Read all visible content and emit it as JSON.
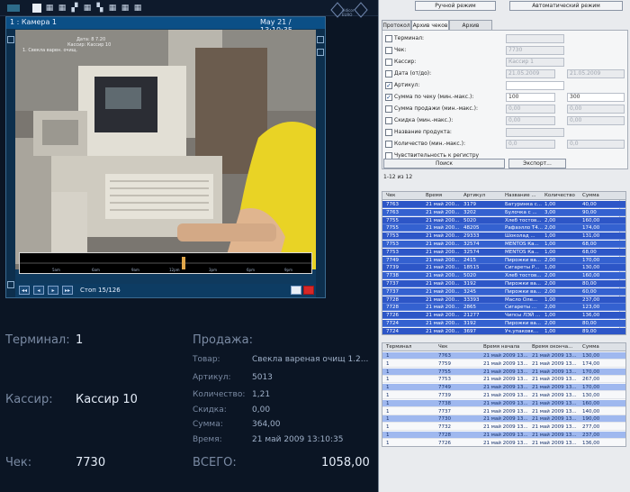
{
  "brand": {
    "line1": "vidicor",
    "line2": "EURO"
  },
  "camera": {
    "title": "1 : Камера 1",
    "datetime": "May 21 / 13:10:35",
    "side_tab": "1 : Камера 1",
    "overlay": [
      "Дата: 8 7.20",
      "Кассир: Кассир 10",
      "1. Свекла варен. очищ."
    ],
    "timeline_ticks": [
      "5am",
      "6am",
      "9am",
      "12pm",
      "3pm",
      "6pm",
      "9pm"
    ],
    "frame_counter": "Стоп  15/126"
  },
  "left_info": {
    "terminal_label": "Терминал:",
    "terminal_value": "1",
    "cashier_label": "Кассир:",
    "cashier_value": "Кассир 10",
    "check_label": "Чек:",
    "check_value": "7730",
    "sale_label": "Продажа:",
    "product_label": "Товар:",
    "product_value": "Свекла вареная очищ 1.2...",
    "article_label": "Артикул:",
    "article_value": "5013",
    "qty_label": "Количество:",
    "qty_value": "1,21",
    "discount_label": "Скидка:",
    "discount_value": "0,00",
    "sum_label": "Сумма:",
    "sum_value": "364,00",
    "time_label": "Время:",
    "time_value": "21 май 2009 13:10:35",
    "total_label": "ВСЕГО:",
    "total_value": "1058,00"
  },
  "right": {
    "manual_mode": "Ручной режим",
    "auto_mode": "Автоматический режим",
    "tabs": [
      "Протокол",
      "Архив чеков",
      "Архив событий"
    ],
    "filters": [
      {
        "label": "Терминал:",
        "checked": false,
        "v1": "",
        "v2": ""
      },
      {
        "label": "Чек:",
        "checked": false,
        "v1": "7730",
        "v2": ""
      },
      {
        "label": "Кассир:",
        "checked": false,
        "v1": "Кассир 1",
        "v2": ""
      },
      {
        "label": "Дата (от/до):",
        "checked": false,
        "v1": "21.05.2009",
        "v2": "21.05.2009"
      },
      {
        "label": "Артикул:",
        "checked": true,
        "v1": "",
        "v2": ""
      },
      {
        "label": "Сумма по чеку (мин.-макс.):",
        "checked": true,
        "v1": "100",
        "v2": "300"
      },
      {
        "label": "Сумма продажи (мин.-макс.):",
        "checked": false,
        "v1": "0,00",
        "v2": "0,00"
      },
      {
        "label": "Скидка (мин.-макс.):",
        "checked": false,
        "v1": "0,00",
        "v2": "0,00"
      },
      {
        "label": "Название продукта:",
        "checked": false,
        "v1": "",
        "v2": ""
      },
      {
        "label": "Количество (мин.-макс.):",
        "checked": false,
        "v1": "0,0",
        "v2": "0,0"
      },
      {
        "label": "Чувствительность к регистру",
        "checked": false,
        "v1": "",
        "v2": ""
      }
    ],
    "search_btn": "Поиск",
    "export_btn": "Экспорт...",
    "count": "1-12 из 12",
    "grid1_headers": [
      "Чек",
      "Время",
      "Артикул",
      "Название ...",
      "Количество",
      "Сумма"
    ],
    "grid1_rows": [
      [
        "7763",
        "21 май 200...",
        "3179",
        "Батуринка с...",
        "1,00",
        "40,00"
      ],
      [
        "7763",
        "21 май 200...",
        "3202",
        "Булочка с ...",
        "3,00",
        "90,00"
      ],
      [
        "7755",
        "21 май 200...",
        "5020",
        "Хлеб тостов...",
        "2,00",
        "160,00"
      ],
      [
        "7755",
        "21 май 200...",
        "48205",
        "Рафаэлло Т4...",
        "2,00",
        "174,00"
      ],
      [
        "7753",
        "21 май 200...",
        "29333",
        "Шоколад ...",
        "1,00",
        "131,00"
      ],
      [
        "7753",
        "21 май 200...",
        "32574",
        "MENTOS Ка...",
        "1,00",
        "68,00"
      ],
      [
        "7753",
        "21 май 200...",
        "32574",
        "MENTOS Ка...",
        "1,00",
        "68,00"
      ],
      [
        "7749",
        "21 май 200...",
        "2415",
        "Пирожки ва...",
        "2,00",
        "170,00"
      ],
      [
        "7739",
        "21 май 200...",
        "18515",
        "Сигареты Р...",
        "1,00",
        "130,00"
      ],
      [
        "7738",
        "21 май 200...",
        "5020",
        "Хлеб тостов...",
        "2,00",
        "160,00"
      ],
      [
        "7737",
        "21 май 200...",
        "3192",
        "Пирожки ва...",
        "2,00",
        "80,00"
      ],
      [
        "7737",
        "21 май 200...",
        "3245",
        "Пирожки ва...",
        "2,00",
        "60,00"
      ],
      [
        "7728",
        "21 май 200...",
        "33393",
        "Масло Оле...",
        "1,00",
        "237,00"
      ],
      [
        "7728",
        "21 май 200...",
        "2865",
        "Сигареты ...",
        "2,00",
        "123,00"
      ],
      [
        "7726",
        "21 май 200...",
        "21277",
        "Чипсы ЛЭЙ ...",
        "1,00",
        "136,00"
      ],
      [
        "7724",
        "21 май 200...",
        "3192",
        "Пирожки ва...",
        "2,00",
        "80,00"
      ],
      [
        "7724",
        "21 май 200...",
        "3697",
        "Уч.упаковк...",
        "1,00",
        "89,00"
      ]
    ],
    "grid2_headers": [
      "Терминал",
      "Чек",
      "Время начала",
      "Время оконча...",
      "Сумма"
    ],
    "grid2_rows": [
      [
        "1",
        "7763",
        "21 май 2009 13...",
        "21 май 2009 13...",
        "130,00"
      ],
      [
        "1",
        "7759",
        "21 май 2009 13...",
        "21 май 2009 13...",
        "174,00"
      ],
      [
        "1",
        "7755",
        "21 май 2009 13...",
        "21 май 2009 13...",
        "170,00"
      ],
      [
        "1",
        "7753",
        "21 май 2009 13...",
        "21 май 2009 13...",
        "267,00"
      ],
      [
        "1",
        "7749",
        "21 май 2009 13...",
        "21 май 2009 13...",
        "170,00"
      ],
      [
        "1",
        "7739",
        "21 май 2009 13...",
        "21 май 2009 13...",
        "130,00"
      ],
      [
        "1",
        "7738",
        "21 май 2009 13...",
        "21 май 2009 13...",
        "160,00"
      ],
      [
        "1",
        "7737",
        "21 май 2009 13...",
        "21 май 2009 13...",
        "140,00"
      ],
      [
        "1",
        "7730",
        "21 май 2009 13...",
        "21 май 2009 13...",
        "190,00"
      ],
      [
        "1",
        "7732",
        "21 май 2009 13...",
        "21 май 2009 13...",
        "277,00"
      ],
      [
        "1",
        "7728",
        "21 май 2009 13...",
        "21 май 2009 13...",
        "237,00"
      ],
      [
        "1",
        "7726",
        "21 май 2009 13...",
        "21 май 2009 13...",
        "136,00"
      ],
      [
        "1",
        "7724",
        "21 май 2009 13...",
        "21 май 2009 13...",
        "170,00"
      ]
    ]
  }
}
